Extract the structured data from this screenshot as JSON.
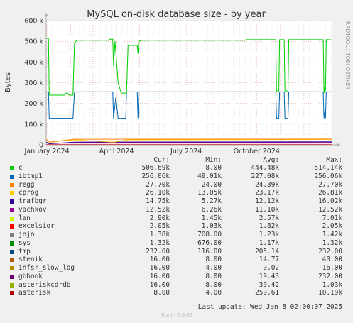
{
  "title": "MySQL on-disk database size - by year",
  "side_text": "RRDTOOL / TOBI OETIKER",
  "ylabel": "Bytes",
  "header": {
    "cur": "Cur:",
    "min": "Min:",
    "avg": "Avg:",
    "max": "Max:"
  },
  "last_update": "Last update: Wed Jan  8 02:00:07 2025",
  "footer": "Munin 2.0.65",
  "colors": {
    "background": "#f0f0f0",
    "plot": "#ffffff",
    "grid_major": "#e8b4b4",
    "grid_minor": "#e0e0e0",
    "axis": "#aaaaaa"
  },
  "legend": [
    {
      "name": "c",
      "color": "#00cc00",
      "cur": "506.69k",
      "min": "8.00",
      "avg": "444.48k",
      "max": "514.14k"
    },
    {
      "name": "ibtmp1",
      "color": "#0066b3",
      "cur": "256.06k",
      "min": "49.01k",
      "avg": "227.08k",
      "max": "256.06k"
    },
    {
      "name": "regg",
      "color": "#ff8000",
      "cur": "27.70k",
      "min": "24.00",
      "avg": "24.39k",
      "max": "27.70k"
    },
    {
      "name": "cprog",
      "color": "#ffcc00",
      "cur": "26.10k",
      "min": "13.05k",
      "avg": "23.17k",
      "max": "26.81k"
    },
    {
      "name": "trafbgr",
      "color": "#330099",
      "cur": "14.75k",
      "min": "5.27k",
      "avg": "12.12k",
      "max": "16.02k"
    },
    {
      "name": "vachkov",
      "color": "#990099",
      "cur": "12.52k",
      "min": "6.26k",
      "avg": "11.10k",
      "max": "12.52k"
    },
    {
      "name": "lan",
      "color": "#ccff00",
      "cur": "2.90k",
      "min": "1.45k",
      "avg": "2.57k",
      "max": "7.01k"
    },
    {
      "name": "excelsior",
      "color": "#ff0000",
      "cur": "2.05k",
      "min": "1.03k",
      "avg": "1.82k",
      "max": "2.05k"
    },
    {
      "name": "jojo",
      "color": "#808080",
      "cur": "1.38k",
      "min": "708.00",
      "avg": "1.23k",
      "max": "1.42k"
    },
    {
      "name": "sys",
      "color": "#008f00",
      "cur": "1.32k",
      "min": "676.00",
      "avg": "1.17k",
      "max": "1.32k"
    },
    {
      "name": "tmp",
      "color": "#00487d",
      "cur": "232.00",
      "min": "116.00",
      "avg": "205.14",
      "max": "232.00"
    },
    {
      "name": "stenik",
      "color": "#b35a00",
      "cur": "16.00",
      "min": "8.00",
      "avg": "14.77",
      "max": "40.00"
    },
    {
      "name": "infsr_slow_log",
      "color": "#b38f00",
      "cur": "16.00",
      "min": "4.00",
      "avg": "9.02",
      "max": "16.00"
    },
    {
      "name": "gbbook",
      "color": "#6b006b",
      "cur": "16.00",
      "min": "8.00",
      "avg": "19.43",
      "max": "232.00"
    },
    {
      "name": "asteriskcdrdb",
      "color": "#8fb300",
      "cur": "16.00",
      "min": "8.00",
      "avg": "39.42",
      "max": "1.03k"
    },
    {
      "name": "asterisk",
      "color": "#b30000",
      "cur": "8.00",
      "min": "4.00",
      "avg": "259.61",
      "max": "10.19k"
    }
  ],
  "chart_data": {
    "type": "line",
    "title": "MySQL on-disk database size - by year",
    "ylabel": "Bytes",
    "xlim": [
      "2023-12-31",
      "2025-01-08"
    ],
    "ylim": [
      0,
      600000
    ],
    "yticks": [
      0,
      100000,
      200000,
      300000,
      400000,
      500000,
      600000
    ],
    "ytick_labels": [
      "0",
      "100 k",
      "200 k",
      "300 k",
      "400 k",
      "500 k",
      "600 k"
    ],
    "xticks": [
      {
        "date": "2024-01-01",
        "label": "January 2024"
      },
      {
        "date": "2024-04-01",
        "label": "April 2024"
      },
      {
        "date": "2024-07-01",
        "label": "July 2024"
      },
      {
        "date": "2024-10-01",
        "label": "October 2024"
      }
    ],
    "grid": true,
    "series": [
      {
        "name": "c",
        "color": "#00cc00",
        "points": [
          [
            "2023-12-31",
            514000
          ],
          [
            "2024-01-03",
            514000
          ],
          [
            "2024-01-04",
            240000
          ],
          [
            "2024-01-24",
            240000
          ],
          [
            "2024-01-26",
            250000
          ],
          [
            "2024-01-28",
            250000
          ],
          [
            "2024-01-30",
            240000
          ],
          [
            "2024-02-04",
            240000
          ],
          [
            "2024-02-06",
            490000
          ],
          [
            "2024-02-09",
            505000
          ],
          [
            "2024-03-22",
            505000
          ],
          [
            "2024-03-23",
            510000
          ],
          [
            "2024-03-27",
            510000
          ],
          [
            "2024-03-28",
            380000
          ],
          [
            "2024-03-30",
            500000
          ],
          [
            "2024-04-03",
            300000
          ],
          [
            "2024-04-07",
            250000
          ],
          [
            "2024-04-14",
            250000
          ],
          [
            "2024-04-16",
            480000
          ],
          [
            "2024-04-28",
            480000
          ],
          [
            "2024-04-29",
            440000
          ],
          [
            "2024-04-30",
            505000
          ],
          [
            "2024-05-02",
            500000
          ],
          [
            "2024-05-04",
            505000
          ],
          [
            "2024-09-16",
            505000
          ],
          [
            "2024-09-17",
            508000
          ],
          [
            "2024-10-26",
            508000
          ],
          [
            "2024-10-27",
            260000
          ],
          [
            "2024-10-30",
            260000
          ],
          [
            "2024-10-31",
            508000
          ],
          [
            "2024-11-06",
            508000
          ],
          [
            "2024-11-07",
            260000
          ],
          [
            "2024-11-11",
            260000
          ],
          [
            "2024-11-12",
            508000
          ],
          [
            "2024-12-27",
            508000
          ],
          [
            "2024-12-28",
            250000
          ],
          [
            "2024-12-29",
            280000
          ],
          [
            "2024-12-30",
            260000
          ],
          [
            "2024-12-31",
            508000
          ],
          [
            "2025-01-08",
            506690
          ]
        ]
      },
      {
        "name": "ibtmp1",
        "color": "#0066b3",
        "points": [
          [
            "2023-12-31",
            256000
          ],
          [
            "2024-01-03",
            256000
          ],
          [
            "2024-01-04",
            128000
          ],
          [
            "2024-02-04",
            128000
          ],
          [
            "2024-02-06",
            256000
          ],
          [
            "2024-03-27",
            256000
          ],
          [
            "2024-03-28",
            128000
          ],
          [
            "2024-03-31",
            230000
          ],
          [
            "2024-04-03",
            128000
          ],
          [
            "2024-04-13",
            128000
          ],
          [
            "2024-04-14",
            256000
          ],
          [
            "2024-04-28",
            256000
          ],
          [
            "2024-04-29",
            128000
          ],
          [
            "2024-04-30",
            256000
          ],
          [
            "2024-10-26",
            256000
          ],
          [
            "2024-10-27",
            128000
          ],
          [
            "2024-10-30",
            128000
          ],
          [
            "2024-10-31",
            256000
          ],
          [
            "2024-11-06",
            256000
          ],
          [
            "2024-11-07",
            128000
          ],
          [
            "2024-11-11",
            128000
          ],
          [
            "2024-11-12",
            256000
          ],
          [
            "2024-12-27",
            256000
          ],
          [
            "2024-12-28",
            128000
          ],
          [
            "2024-12-29",
            160000
          ],
          [
            "2024-12-30",
            128000
          ],
          [
            "2024-12-31",
            256000
          ],
          [
            "2025-01-08",
            256060
          ]
        ]
      },
      {
        "name": "regg",
        "color": "#ff8000",
        "points": [
          [
            "2023-12-31",
            27700
          ],
          [
            "2024-01-04",
            13000
          ],
          [
            "2024-02-06",
            27000
          ],
          [
            "2025-01-08",
            27700
          ]
        ]
      },
      {
        "name": "cprog",
        "color": "#ffcc00",
        "points": [
          [
            "2023-12-31",
            26000
          ],
          [
            "2024-01-04",
            13050
          ],
          [
            "2024-02-06",
            24000
          ],
          [
            "2024-03-28",
            13050
          ],
          [
            "2024-04-16",
            24000
          ],
          [
            "2025-01-08",
            26100
          ]
        ]
      },
      {
        "name": "trafbgr",
        "color": "#330099",
        "points": [
          [
            "2023-12-31",
            14000
          ],
          [
            "2024-01-04",
            5270
          ],
          [
            "2024-02-06",
            13000
          ],
          [
            "2025-01-08",
            14750
          ]
        ]
      },
      {
        "name": "vachkov",
        "color": "#990099",
        "points": [
          [
            "2023-12-31",
            12000
          ],
          [
            "2024-01-04",
            6260
          ],
          [
            "2024-02-06",
            11000
          ],
          [
            "2025-01-08",
            12520
          ]
        ]
      },
      {
        "name": "excelsior",
        "color": "#ff0000",
        "points": [
          [
            "2023-12-31",
            2000
          ],
          [
            "2025-01-08",
            2050
          ]
        ]
      }
    ]
  }
}
